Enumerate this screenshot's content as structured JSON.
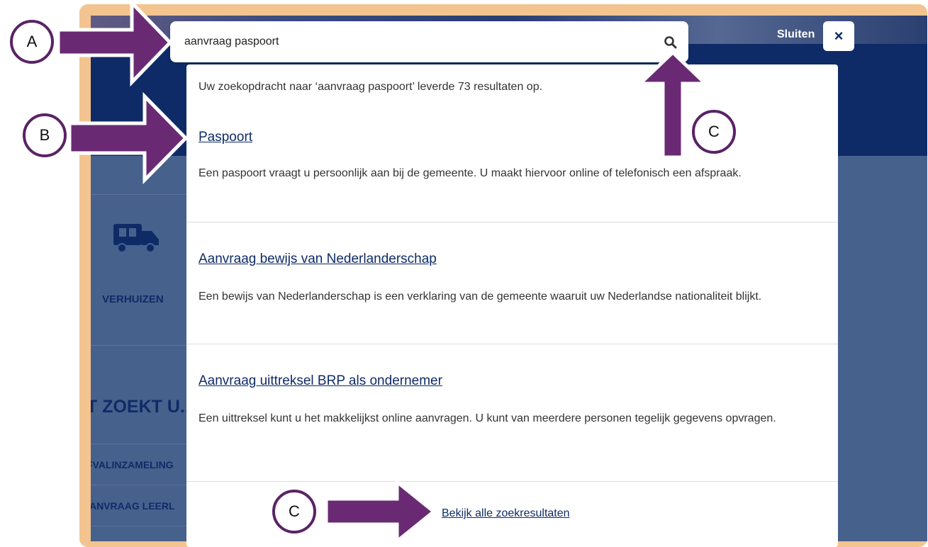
{
  "search": {
    "query": "aanvraag paspoort"
  },
  "close_label": "Sluiten",
  "close_icon": "×",
  "summary": "Uw zoekopdracht naar ‘aanvraag paspoort’ leverde 73 resultaten op.",
  "results": [
    {
      "title": "Paspoort",
      "description": "Een paspoort vraagt u persoonlijk aan bij de gemeente. U maakt hiervoor online of telefonisch een afspraak."
    },
    {
      "title": "Aanvraag bewijs van Nederlanderschap",
      "description": "Een bewijs van Nederlanderschap is een verklaring van de gemeente waaruit uw Nederlandse nationaliteit blijkt."
    },
    {
      "title": "Aanvraag uittreksel BRP als ondernemer",
      "description": "Een uittreksel kunt u het makkelijkst online aanvragen. U kunt van meerdere personen tegelijk gegevens opvragen."
    }
  ],
  "all_results_label": "Bekijk alle zoekresultaten",
  "background": {
    "tile_label": "VERHUIZEN",
    "heading": "T ZOEKT U...",
    "links": [
      "FVALINZAMELING",
      "ANVRAAG LEERL"
    ]
  },
  "annotations": {
    "a": "A",
    "b": "B",
    "c1": "C",
    "c2": "C"
  },
  "colors": {
    "frame": "#f3c48f",
    "arrow": "#6a2a73",
    "navy": "#0f2b67",
    "overlay": "#47618d"
  }
}
